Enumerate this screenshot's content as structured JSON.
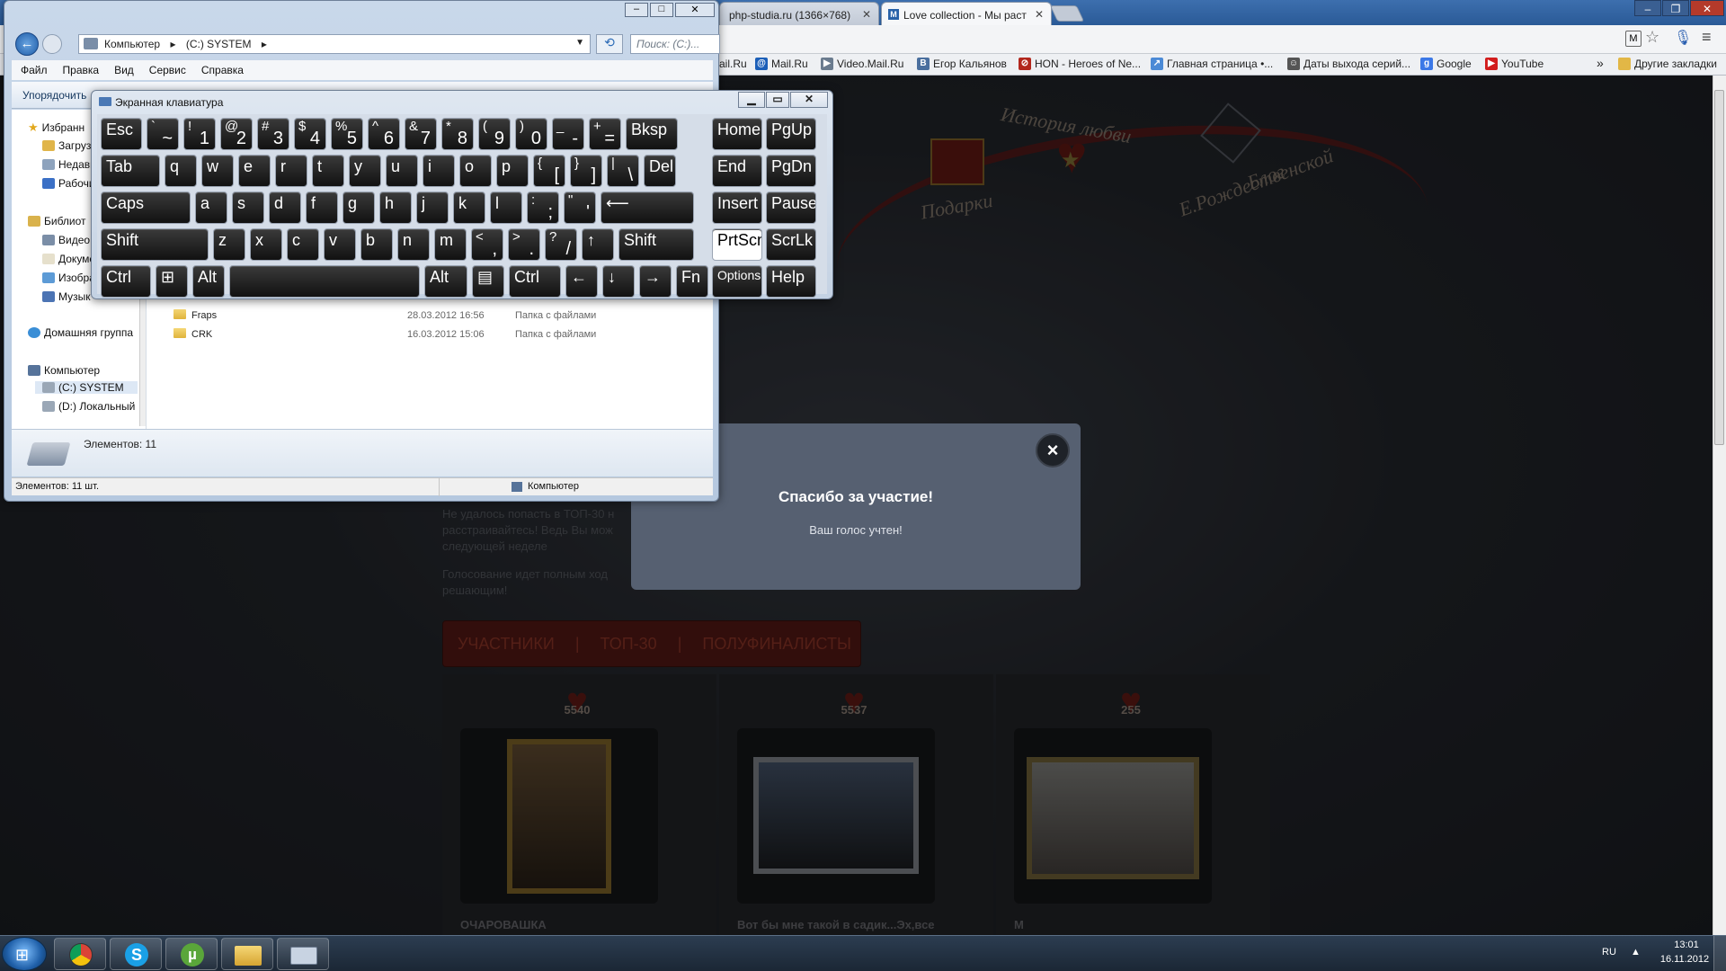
{
  "browser": {
    "tabs": [
      {
        "label": "php-studia.ru (1366×768)",
        "active": false
      },
      {
        "label": "Love collection - Мы раст",
        "active": true
      }
    ],
    "bookmarks": [
      {
        "label": "ail.Ru",
        "icon": "mailru-icon"
      },
      {
        "label": "Mail.Ru",
        "icon": "mailru-at-icon"
      },
      {
        "label": "Video.Mail.Ru",
        "icon": "video-icon"
      },
      {
        "label": "Егор Кальянов",
        "icon": "vk-icon"
      },
      {
        "label": "HON - Heroes of Ne...",
        "icon": "hon-icon"
      },
      {
        "label": "Главная страница •...",
        "icon": "page-icon"
      },
      {
        "label": "Даты выхода серий...",
        "icon": "tv-icon"
      },
      {
        "label": "Google",
        "icon": "google-icon"
      },
      {
        "label": "YouTube",
        "icon": "youtube-icon"
      }
    ],
    "bookmarks_more": "»",
    "other_bookmarks": "Другие закладки"
  },
  "site": {
    "ribbon_labels": [
      "История любви",
      "Подарки",
      "Блог",
      "Е.Рождественской"
    ],
    "info_text_1": [
      "Не удалось попасть в ТОП-30 н",
      "расстраивайтесь! Ведь Вы мож",
      "следующей неделе"
    ],
    "info_text_2": [
      "Голосование идет полным ход",
      "решающим!"
    ],
    "tabs": [
      "УЧАСТНИКИ",
      "ТОП-30",
      "ПОЛУФИНАЛИСТЫ"
    ],
    "tab_separator": "|",
    "cards": [
      {
        "votes": "5540",
        "title": "ОЧАРОВАШКА"
      },
      {
        "votes": "5537",
        "title": "Вот бы мне такой в садик...Эх,все"
      },
      {
        "votes": "255",
        "title": "М"
      }
    ]
  },
  "modal": {
    "title": "Спасибо за участие!",
    "text": "Ваш голос учтен!",
    "close": "×"
  },
  "explorer": {
    "breadcrumb": [
      "Компьютер",
      "(C:) SYSTEM"
    ],
    "search_placeholder": "Поиск: (C:)...",
    "menu": [
      "Файл",
      "Правка",
      "Вид",
      "Сервис",
      "Справка"
    ],
    "toolbar_organize": "Упорядочить",
    "tree": [
      {
        "label": "Избранн"
      },
      {
        "label": "Загрузк"
      },
      {
        "label": "Недавн"
      },
      {
        "label": "Рабочи"
      },
      {
        "label": "Библиот"
      },
      {
        "label": "Видео"
      },
      {
        "label": "Докуме"
      },
      {
        "label": "Изобра"
      },
      {
        "label": "Музык"
      },
      {
        "label": "Домашняя группа"
      },
      {
        "label": "Компьютер"
      },
      {
        "label": "(C:) SYSTEM"
      },
      {
        "label": "(D:) Локальный"
      }
    ],
    "files": [
      {
        "name": "Fraps",
        "date": "28.03.2012 16:56",
        "type": "Папка с файлами"
      },
      {
        "name": "CRK",
        "date": "16.03.2012 15:06",
        "type": "Папка с файлами"
      }
    ],
    "details_count": "Элементов: 11",
    "status_left": "Элементов: 11 шт.",
    "status_right": "Компьютер"
  },
  "osk": {
    "title": "Экранная клавиатура",
    "rows": [
      [
        {
          "t": "Esc"
        },
        {
          "s": "`",
          "t": "~"
        },
        {
          "s": "!",
          "t": "1"
        },
        {
          "s": "@",
          "t": "2"
        },
        {
          "s": "#",
          "t": "3"
        },
        {
          "s": "$",
          "t": "4"
        },
        {
          "s": "%",
          "t": "5"
        },
        {
          "s": "^",
          "t": "6"
        },
        {
          "s": "&",
          "t": "7"
        },
        {
          "s": "*",
          "t": "8"
        },
        {
          "s": "(",
          "t": "9"
        },
        {
          "s": ")",
          "t": "0"
        },
        {
          "s": "_",
          "t": "-"
        },
        {
          "s": "+",
          "t": "="
        },
        {
          "t": "Bksp"
        }
      ],
      [
        {
          "t": "Tab"
        },
        {
          "t": "q"
        },
        {
          "t": "w"
        },
        {
          "t": "e"
        },
        {
          "t": "r"
        },
        {
          "t": "t"
        },
        {
          "t": "y"
        },
        {
          "t": "u"
        },
        {
          "t": "i"
        },
        {
          "t": "o"
        },
        {
          "t": "p"
        },
        {
          "s": "{",
          "t": "["
        },
        {
          "s": "}",
          "t": "]"
        },
        {
          "s": "|",
          "t": "\\"
        },
        {
          "t": "Del"
        }
      ],
      [
        {
          "t": "Caps"
        },
        {
          "t": "a"
        },
        {
          "t": "s"
        },
        {
          "t": "d"
        },
        {
          "t": "f"
        },
        {
          "t": "g"
        },
        {
          "t": "h"
        },
        {
          "t": "j"
        },
        {
          "t": "k"
        },
        {
          "t": "l"
        },
        {
          "s": ":",
          "t": ";"
        },
        {
          "s": "\"",
          "t": "'"
        },
        {
          "t": "⟵"
        }
      ],
      [
        {
          "t": "Shift"
        },
        {
          "t": "z"
        },
        {
          "t": "x"
        },
        {
          "t": "c"
        },
        {
          "t": "v"
        },
        {
          "t": "b"
        },
        {
          "t": "n"
        },
        {
          "t": "m"
        },
        {
          "s": "<",
          "t": ","
        },
        {
          "s": ">",
          "t": "."
        },
        {
          "s": "?",
          "t": "/"
        },
        {
          "t": "↑"
        },
        {
          "t": "Shift"
        }
      ],
      [
        {
          "t": "Ctrl"
        },
        {
          "t": "⊞"
        },
        {
          "t": "Alt"
        },
        {
          "t": ""
        },
        {
          "t": "Alt"
        },
        {
          "t": "▤"
        },
        {
          "t": "Ctrl"
        },
        {
          "t": "←"
        },
        {
          "t": "↓"
        },
        {
          "t": "→"
        },
        {
          "t": "Fn"
        }
      ]
    ],
    "side": [
      [
        "Home",
        "PgUp"
      ],
      [
        "End",
        "PgDn"
      ],
      [
        "Insert",
        "Pause"
      ],
      [
        "PrtScn",
        "ScrLk"
      ],
      [
        "Options",
        "Help"
      ]
    ]
  },
  "taskbar": {
    "lang": "RU",
    "time": "13:01",
    "date": "16.11.2012",
    "apps": [
      "chrome-icon",
      "skype-icon",
      "utorrent-icon",
      "explorer-icon",
      "keyboard-icon"
    ]
  }
}
